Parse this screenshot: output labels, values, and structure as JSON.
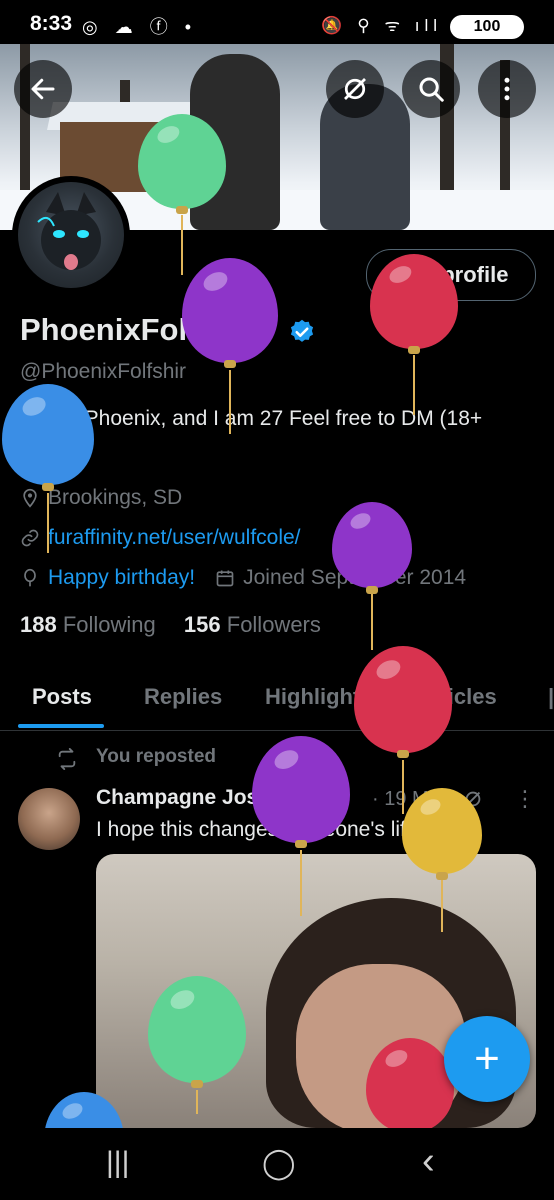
{
  "status_bar": {
    "time": "8:33",
    "left_icons": "◎ ☁ ⓕ •",
    "right_icons": "🔕 ⚲ ᯤ ıll",
    "battery": "100"
  },
  "header": {
    "back_icon": "arrow-left-icon",
    "icons": [
      "translate-off-icon",
      "search-icon",
      "more-vertical-icon"
    ]
  },
  "profile": {
    "edit_label": "Edit profile",
    "name": "PhoenixFolfshir",
    "handle": "@PhoenixFolfshir",
    "bio": "Hi, I'm Phoenix, and I am 27  Feel free to DM  (18+ only!!!)",
    "location": "Brookings, SD",
    "website": "furaffinity.net/user/wulfcole/",
    "birthday": "Happy birthday!",
    "joined": "Joined September 2014",
    "following_count": "188",
    "following_label": "Following",
    "followers_count": "156",
    "followers_label": "Followers"
  },
  "tabs": [
    "Posts",
    "Replies",
    "Highlights",
    "Articles"
  ],
  "post": {
    "reposted_label": "You reposted",
    "author": "Champagne Joshi",
    "ellipsis": "...",
    "date": "· 19 May",
    "text": "I hope this changes someone's life."
  },
  "fab_label": "+",
  "navbar": {
    "recent": "|||",
    "home": "◯",
    "back": "‹"
  },
  "colors": {
    "accent": "#1d9bf0",
    "background": "#000000",
    "balloon_green": "#5fd394",
    "balloon_purple": "#8e35c9",
    "balloon_red": "#d8334f",
    "balloon_blue": "#3a8ee6",
    "balloon_yellow": "#e2b93a"
  }
}
